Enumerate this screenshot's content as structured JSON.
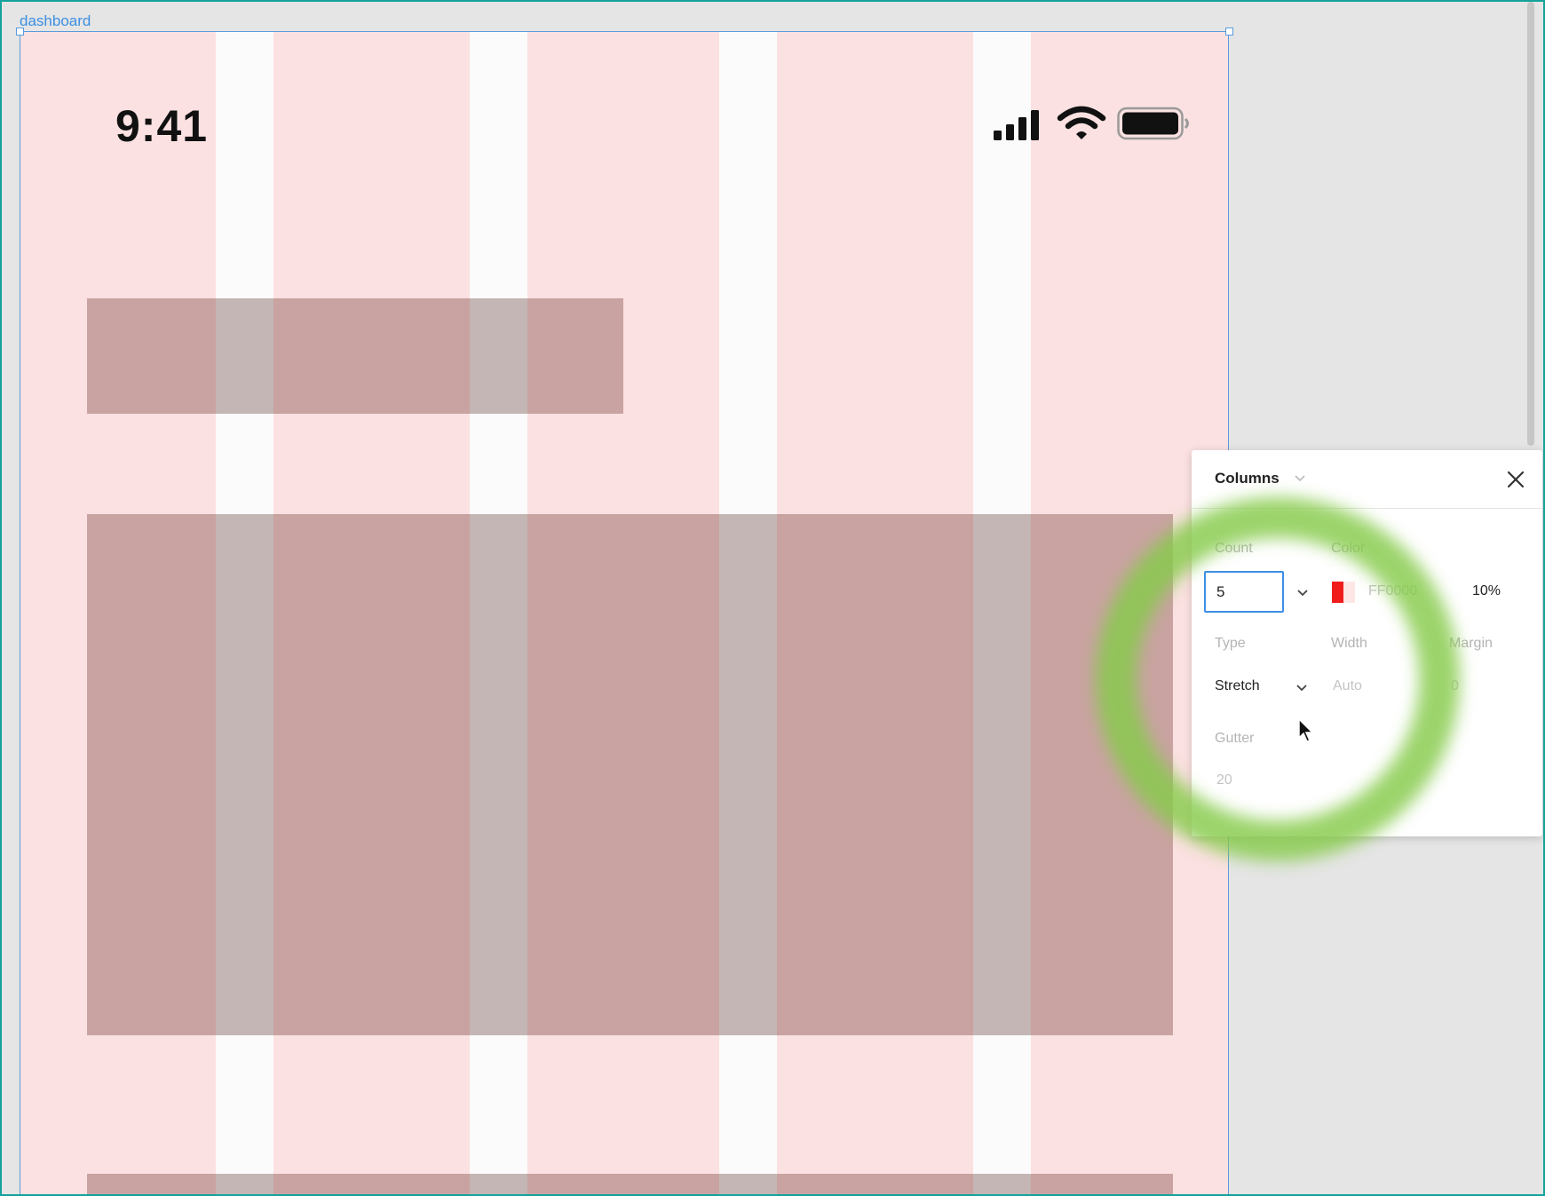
{
  "frame": {
    "label": "dashboard"
  },
  "status_bar": {
    "time": "9:41",
    "icons": [
      "cellular-signal-icon",
      "wifi-icon",
      "battery-icon"
    ]
  },
  "layout_grid": {
    "color": "#FF0000",
    "opacity_percent": 10
  },
  "grid_panel": {
    "title": "Columns",
    "count_label": "Count",
    "count_value": "5",
    "color_label": "Color",
    "color_hex": "FF0000",
    "opacity": "10%",
    "type_label": "Type",
    "type_value": "Stretch",
    "width_label": "Width",
    "width_value": "Auto",
    "margin_label": "Margin",
    "margin_value": "0",
    "gutter_label": "Gutter",
    "gutter_value": "20"
  },
  "colors": {
    "selection": "#5A9BDE",
    "input_focus": "#3D8FE6",
    "highlight_ring": "#86CA4A",
    "frame_background": "#FBFBFB",
    "placeholder_card": "#C3B6B4"
  }
}
